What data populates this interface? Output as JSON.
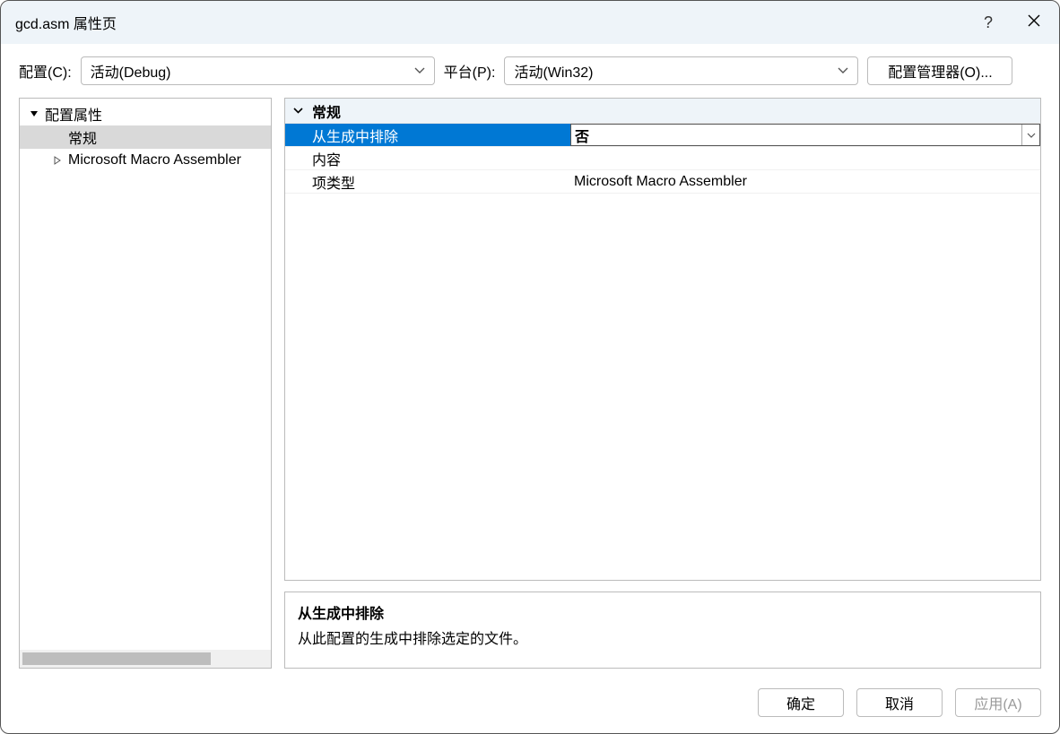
{
  "titlebar": {
    "title": "gcd.asm 属性页",
    "help": "?"
  },
  "toolbar": {
    "config_label": "配置(C):",
    "config_value": "活动(Debug)",
    "platform_label": "平台(P):",
    "platform_value": "活动(Win32)",
    "config_mgr": "配置管理器(O)..."
  },
  "tree": {
    "root": "配置属性",
    "items": [
      {
        "label": "常规",
        "selected": true
      },
      {
        "label": "Microsoft Macro Assembler",
        "expandable": true
      }
    ]
  },
  "grid": {
    "category": "常规",
    "rows": [
      {
        "name": "从生成中排除",
        "value": "否",
        "selected": true
      },
      {
        "name": "内容",
        "value": ""
      },
      {
        "name": "项类型",
        "value": "Microsoft Macro Assembler"
      }
    ]
  },
  "description": {
    "title": "从生成中排除",
    "text": "从此配置的生成中排除选定的文件。"
  },
  "footer": {
    "ok": "确定",
    "cancel": "取消",
    "apply": "应用(A)"
  }
}
